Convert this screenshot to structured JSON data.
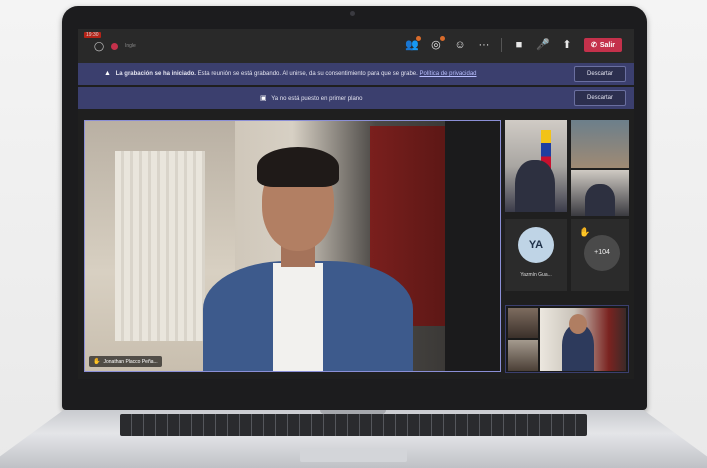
{
  "topbar": {
    "timer": "19:30",
    "small_label": "Ingle",
    "leave_label": "Salir",
    "icons": [
      "participants-icon",
      "chat-icon",
      "share-icon",
      "more-icon",
      "camera-icon",
      "mic-icon",
      "share-screen-icon",
      "phone-hangup-icon"
    ]
  },
  "banners": {
    "recording_title": "La grabación se ha iniciado.",
    "recording_text": "Esta reunión se está grabando. Al unirse, da su consentimiento para que se grabe.",
    "privacy_link": "Política de privacidad",
    "dismiss_label": "Descartar",
    "spotlight_text": "Ya no está puesto en primer plano"
  },
  "main_video": {
    "name": "Jonathan Placco Peña..."
  },
  "side_panel": {
    "avatar_initials": "YA",
    "avatar_name": "Yazmín Gua...",
    "overflow_count": "+104"
  },
  "colors": {
    "accent_banner": "#3b3f6e",
    "leave_button": "#c4314b",
    "video_border": "#8b8fd6"
  }
}
